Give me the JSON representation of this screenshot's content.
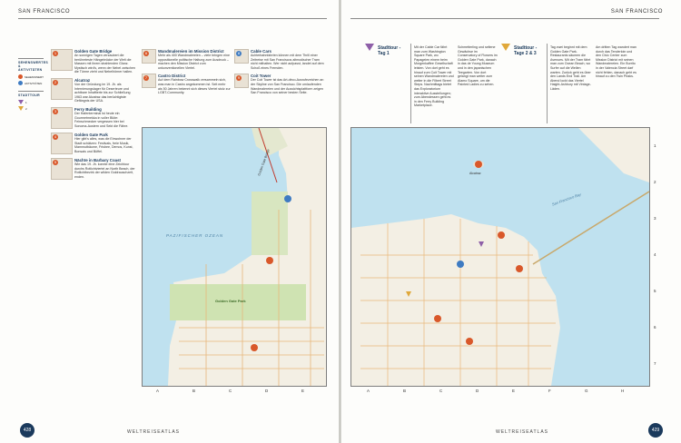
{
  "running_head": {
    "left": "SAN FRANCISCO",
    "right": "SAN FRANCISCO"
  },
  "footer": {
    "left": "WELTREISEATLAS",
    "right": "WELTREISEATLAS"
  },
  "folio": {
    "left": "428",
    "right": "429"
  },
  "legend": {
    "title1": "SEHENSWERTES & AKTIVITÄTEN",
    "items1": [
      {
        "label": "SEHENSWERT",
        "color": "#d9582a"
      },
      {
        "label": "AKTIVITÄTEN",
        "color": "#3e7bc2"
      }
    ],
    "title2": "STADTTOUR",
    "items2": [
      {
        "label": "1",
        "color": "#8e5fa8"
      },
      {
        "label": "2",
        "color": "#e0a83a"
      }
    ]
  },
  "col1": [
    {
      "n": "1",
      "title": "Golden Gate Bridge",
      "text": "An sonnigen Tagen verzaubert die berühmteste Hängebrücke der Welt die Massen mit ihrem strahlenden Glanz. Mystisch wird's, wenn der Nebel zwischen die Türme zieht und Nebelhörner hallen."
    },
    {
      "n": "2",
      "title": "Alcatraz",
      "text": "Von der Gründung im 19. Jh. als Internierungslager für Deserteure und achtbare Inhaftierte bis zur Schließung 1963 war Alcatraz das berüchtigtste Gefängnis der USA."
    },
    {
      "n": "3",
      "title": "Ferry Building",
      "text": "Der Hafenterminal ist heute ein Gourmetmekka in voller Blüte: Feinschmecker vergessen hier bei Sonoma-Austern und Sekt die Fähre."
    },
    {
      "n": "4",
      "title": "Golden Gate Park",
      "text": "Hier gibt's alles, was die Einwohner der Stadt schätzen: Festivals, freie Musik, Mammutbäume, Frisbee, Demos, Kunst, Bonsais und Büffel."
    },
    {
      "n": "5",
      "title": "Nächte in Barbary Coast",
      "text": "Wie das 19. Jh. konnte eine Zeichtour durchs Rotlichtviertel an North Beach, der Rotlichtbezirk der wilden Goldrauschzeit, enden."
    }
  ],
  "col2": [
    {
      "n": "6",
      "title": "Wandmalereien im Mission District",
      "text": "Mehr als 400 Wandmalereien – viele bringen eine oppositionelle politische Haltung zum Ausdruck – machen den Mission District zum unkonventionellen Viertel."
    },
    {
      "n": "7",
      "title": "Castro District",
      "text": "Auf dem Rainbow Crosswalk versammeln sich, was man in Castro angekommen ist. Seit mehr als 50 Jahren bekennt sich dieses Viertel stolz zur LGBT-Community."
    }
  ],
  "col3": [
    {
      "n": "8",
      "title": "Cable Cars",
      "text": "Achterbahnfahrten können mit dem Thrill einer Zeitreise mit San Franciscos altmodischer Tram nicht mithalten. Wer nicht aufpasst, landet auf dem Schoß eines Fremden."
    },
    {
      "n": "9",
      "title": "Coit Tower",
      "text": "Der Coit Tower ist das Art-déco-Ausrufezeichen an der Skyline von San Francisco. Die umlaufenden Wandmalereien und der Aussichtsplattform zeigen San Francisco von seiner besten Seite."
    }
  ],
  "map_left": {
    "ocean_label": "PAZIFISCHER OZEAN",
    "bridge_label": "Golden Gate Bridge",
    "park_label": "Golden Gate Park",
    "columns": [
      "A",
      "B",
      "C",
      "D",
      "E"
    ]
  },
  "stadttour1": {
    "title": "Stadttour - Tag 1",
    "text": "Mit der Cable Car fährt man zum Washington Square Park, wo Papageien einem beim Morgenkaffee Gesellschaft leisten. Von dort geht es hinauf zum Coit Tower mit seinen Wandmalereien und weiter in die Filbert Street Steps. Nachmittags bietet das Exploratorium interaktive Ausstellungen; zum Abendessen geht es in den Ferry Building Marketplace.",
    "text2": "Schmetterling und seltene Gewächse im Conservatory of Flowers im Golden Gate Park, danach in das de Young Museum und in den japanischen Teegarten. Von dort gelangt man weiter zum Alamo Square, um die Painted Ladies zu sehen."
  },
  "stadttour23": {
    "title": "Stadttour - Tage 2 & 3",
    "text": "Tag zwei beginnt mit dem Golden Gate Park. Restaurants säumen die Avenues. Mit der Tram fährt man zum Ocean Beach, wo Surfer auf die Wellen warten. Zurück geht es über den Lands End Trail. Am Abend lockt das Viertel Haight-Ashbury mit Vintage-Läden.",
    "text2": "Am dritten Tag wandert man durch das Tenderloin und den Civic Center zum Mission District mit seinen Wandmalereien. Ein Burrito in der Valencia Street darf nicht fehlen, danach geht es hinauf zu den Twin Peaks."
  },
  "map_right": {
    "bay_label": "San Francisco Bay",
    "island_label": "Alcatraz",
    "columns": [
      "A",
      "B",
      "C",
      "D",
      "E",
      "F",
      "G",
      "H"
    ],
    "rows": [
      "1",
      "2",
      "3",
      "4",
      "5",
      "6",
      "7"
    ]
  }
}
